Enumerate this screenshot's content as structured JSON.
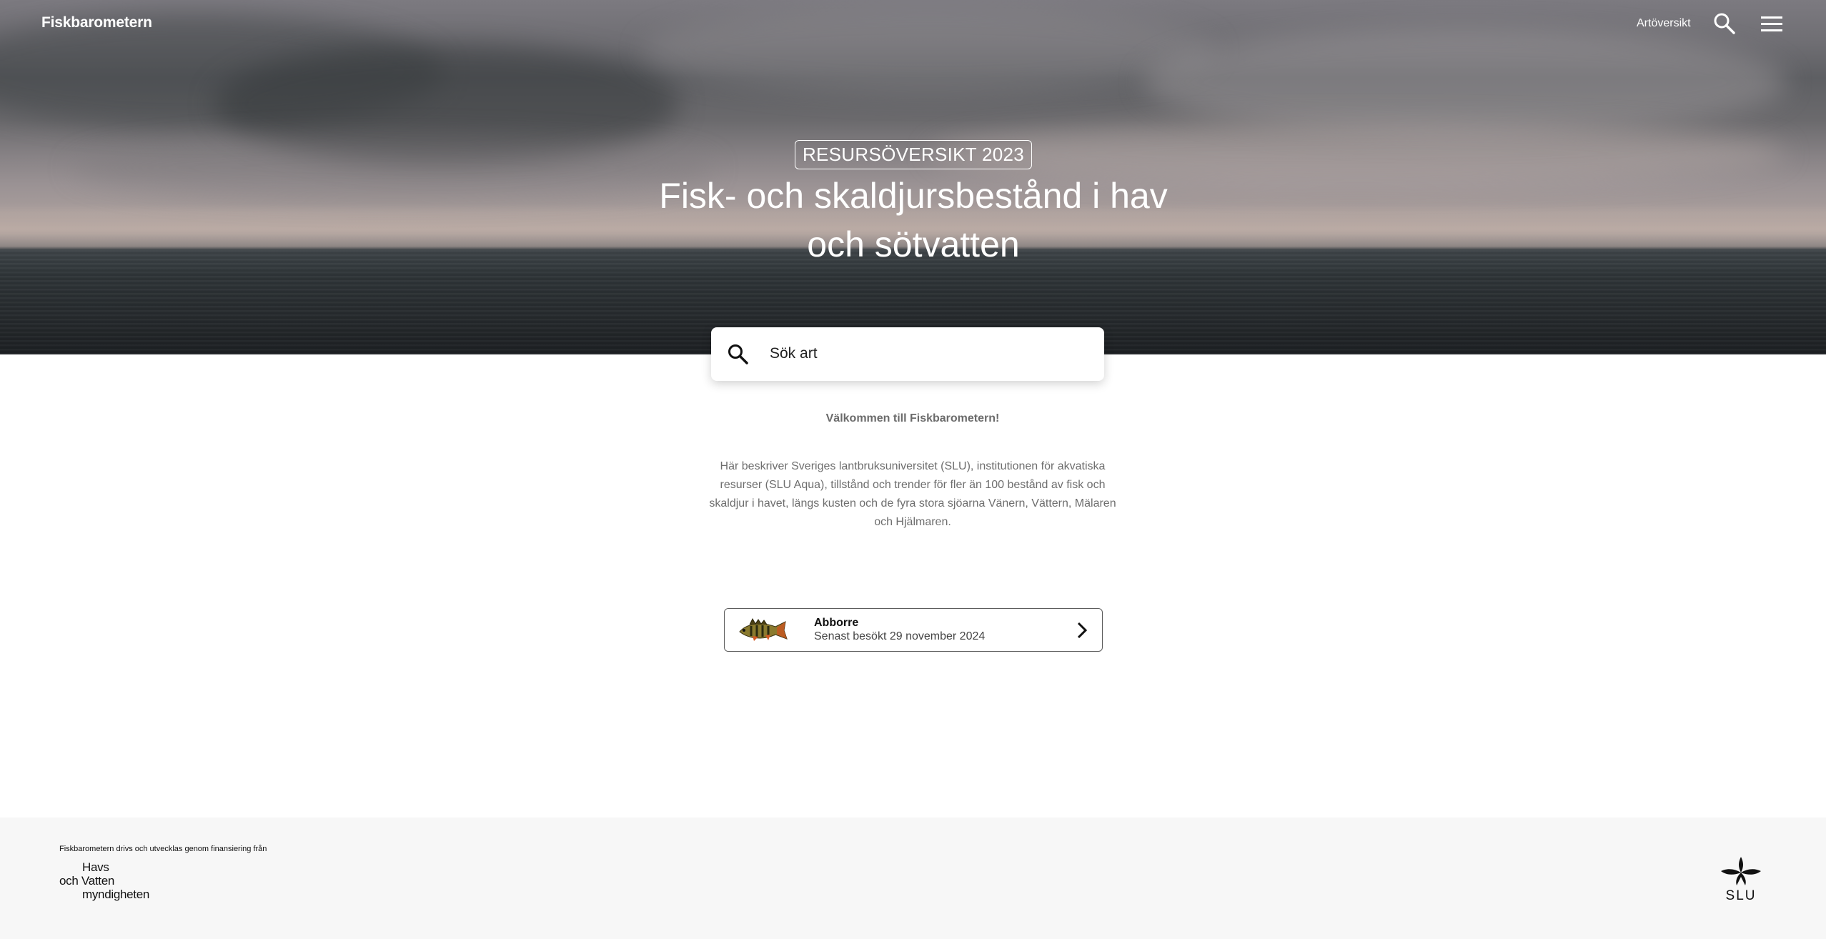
{
  "nav": {
    "brand": "Fiskbarometern",
    "link_label": "Artöversikt",
    "search_icon": "search-icon",
    "menu_icon": "hamburger-menu-icon"
  },
  "hero": {
    "badge": "RESURSÖVERSIKT 2023",
    "title": "Fisk- och skaldjursbestånd i hav och sötvatten"
  },
  "search": {
    "placeholder": "Sök art",
    "icon": "search-icon"
  },
  "welcome": "Välkommen till Fiskbarometern!",
  "intro": "Här beskriver Sveriges lantbruksuniversitet (SLU), institutionen för akvatiska resurser (SLU Aqua), tillstånd och trender för fler än 100 bestånd av fisk och skaldjur i havet, längs kusten och de fyra stora sjöarna Vänern, Vättern, Mälaren och Hjälmaren.",
  "recent": {
    "name": "Abborre",
    "visited": "Senast besökt 29 november 2024",
    "icon": "chevron-right-icon"
  },
  "footer": {
    "funding_text": "Fiskbarometern drivs och utvecklas genom finansiering från",
    "havs_logo": {
      "line1": "Havs",
      "line2": "och Vatten",
      "line3": "myndigheten"
    },
    "slu_logo_text": "SLU"
  },
  "colors": {
    "text_muted": "#6e6e6e",
    "footer_bg": "#f7f7f7",
    "card_border": "#5c5c5c"
  }
}
